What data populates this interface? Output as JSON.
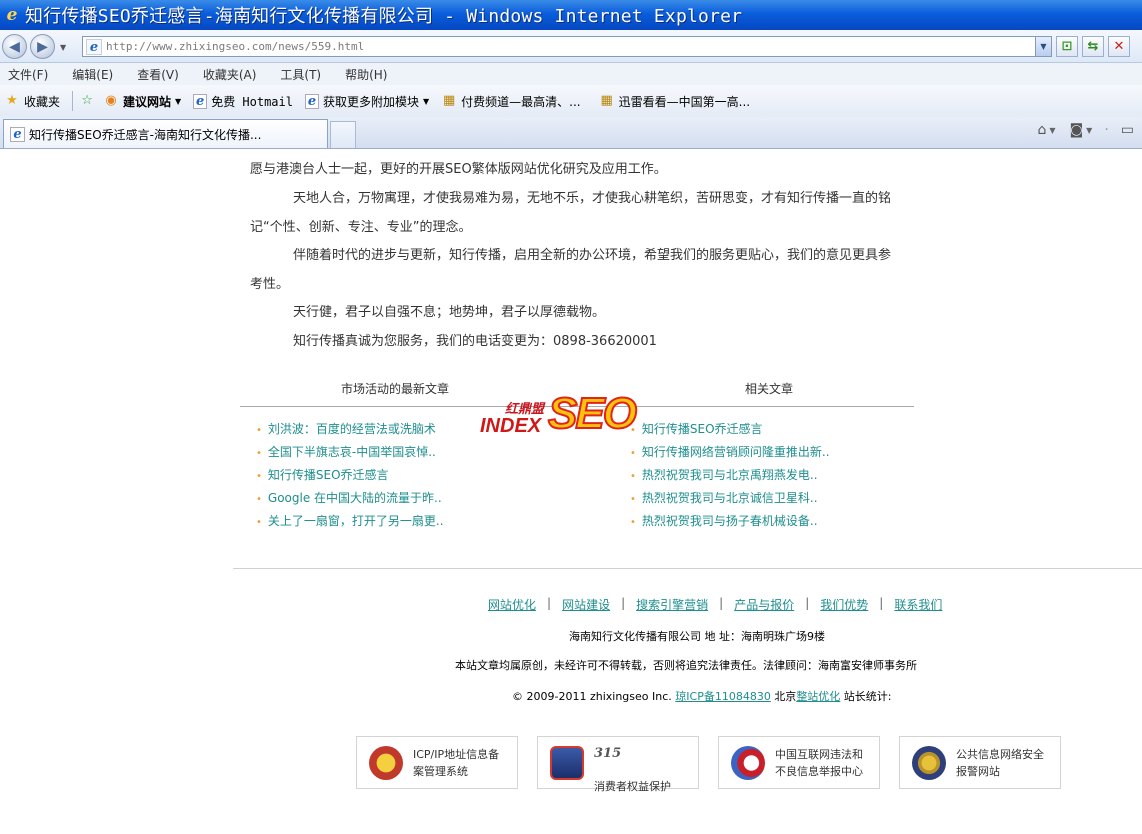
{
  "window": {
    "title": "知行传播SEO乔迁感言-海南知行文化传播有限公司 - Windows Internet Explorer"
  },
  "address_bar": {
    "url": "http://www.zhixingseo.com/news/559.html"
  },
  "menu": [
    "文件(F)",
    "编辑(E)",
    "查看(V)",
    "收藏夹(A)",
    "工具(T)",
    "帮助(H)"
  ],
  "favorites_bar": {
    "favorites_label": "收藏夹",
    "items": [
      "建议网站",
      "免费 Hotmail",
      "获取更多附加模块",
      "付费频道—最高清、...",
      "迅雷看看—中国第一高..."
    ]
  },
  "tabs": {
    "active_label": "知行传播SEO乔迁感言-海南知行文化传播..."
  },
  "article": {
    "paragraphs": [
      "愿与港澳台人士一起，更好的开展SEO繁体版网站优化研究及应用工作。",
      "天地人合，万物寓理，才使我易难为易，无地不乐，才使我心耕笔织，苦研思变，才有知行传播一直的铭记“个性、创新、专注、专业”的理念。",
      "伴随着时代的进步与更新，知行传播，启用全新的办公环境，希望我们的服务更贴心，我们的意见更具参考性。",
      "天行健，君子以自强不息；地势坤，君子以厚德载物。",
      "知行传播真诚为您服务，我们的电话变更为：0898-36620001"
    ]
  },
  "latest": {
    "title": "市场活动的最新文章",
    "items": [
      "刘洪波：百度的经营法或洗脑术",
      "全国下半旗志哀-中国举国哀悼..",
      "知行传播SEO乔迁感言",
      "Google 在中国大陆的流量于昨..",
      "关上了一扇窗，打开了另一扇更.."
    ]
  },
  "related": {
    "title": "相关文章",
    "items": [
      "知行传播SEO乔迁感言",
      "知行传播网络营销顾问隆重推出新..",
      "热烈祝贺我司与北京禹翔燕发电..",
      "热烈祝贺我司与北京诚信卫星科..",
      "热烈祝贺我司与扬子春机械设备.."
    ]
  },
  "watermark": {
    "chinese": "红鼎盟",
    "index": "INDEX",
    "seo": "SEO"
  },
  "footer": {
    "nav": [
      "网站优化",
      "网站建设",
      "搜索引擎营销",
      "产品与报价",
      "我们优势",
      "联系我们"
    ],
    "separator": "|",
    "address": "海南知行文化传播有限公司 地 址：海南明珠广场9楼",
    "notice": "本站文章均属原创，未经许可不得转载，否则将追究法律责任。法律顾问：海南富安律师事务所",
    "copyright_prefix": "© 2009-2011 zhixingseo Inc. ",
    "icp": "琼ICP备11084830",
    "beijing": " 北京",
    "seo_link": "整站优化",
    "stats": " 站长统计:"
  },
  "badges": [
    {
      "text": "ICP/IP地址信息备\n案管理系统"
    },
    {
      "number": "315",
      "text": "消费者权益保护"
    },
    {
      "text": "中国互联网违法和\n不良信息举报中心"
    },
    {
      "text": "公共信息网络安全\n报警网站"
    }
  ]
}
